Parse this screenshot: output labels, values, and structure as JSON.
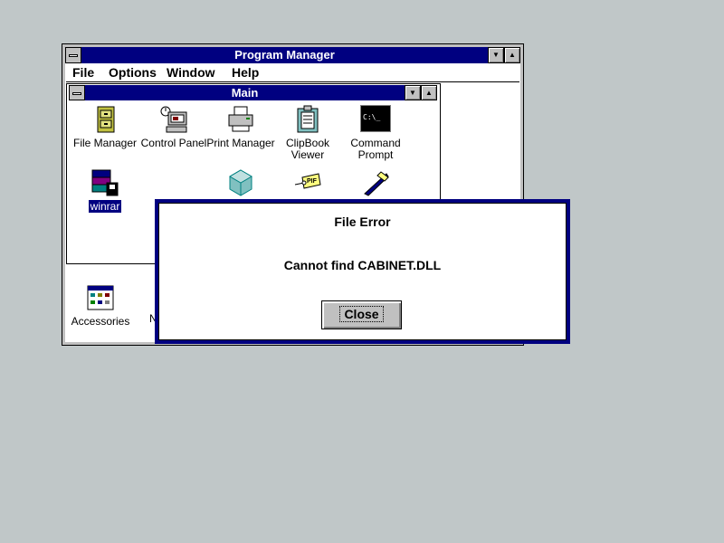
{
  "program_manager": {
    "title": "Program Manager",
    "menu": [
      {
        "label": "File"
      },
      {
        "label": "Options"
      },
      {
        "label": "Window"
      },
      {
        "label": "Help"
      }
    ]
  },
  "main_group": {
    "title": "Main",
    "icons": [
      {
        "label": "File Manager",
        "icon": "file-cabinet-icon"
      },
      {
        "label": "Control Panel",
        "icon": "control-panel-icon"
      },
      {
        "label": "Print Manager",
        "icon": "printer-icon"
      },
      {
        "label": "ClipBook Viewer",
        "icon": "clipbook-icon"
      },
      {
        "label": "Command Prompt",
        "icon": "command-prompt-icon"
      },
      {
        "label": "winrar",
        "icon": "winrar-icon",
        "selected": true
      },
      {
        "label": "",
        "icon": "setup-icon"
      },
      {
        "label": "",
        "icon": "pif-editor-icon"
      },
      {
        "label": "",
        "icon": "read-me-icon"
      }
    ],
    "command_prompt_text": "C:\\_",
    "pif_text": "PIF"
  },
  "minimized_groups": [
    {
      "label": "Accessories",
      "icon": "accessories-icon"
    },
    {
      "label": "N",
      "icon": "group-icon"
    }
  ],
  "dialog": {
    "title": "File Error",
    "message": "Cannot find CABINET.DLL",
    "close_label": "Close"
  },
  "colors": {
    "desktop": "#c0c7c8",
    "title_active": "#000080",
    "window_bg": "#ffffff",
    "button_face": "#c0c0c0"
  }
}
